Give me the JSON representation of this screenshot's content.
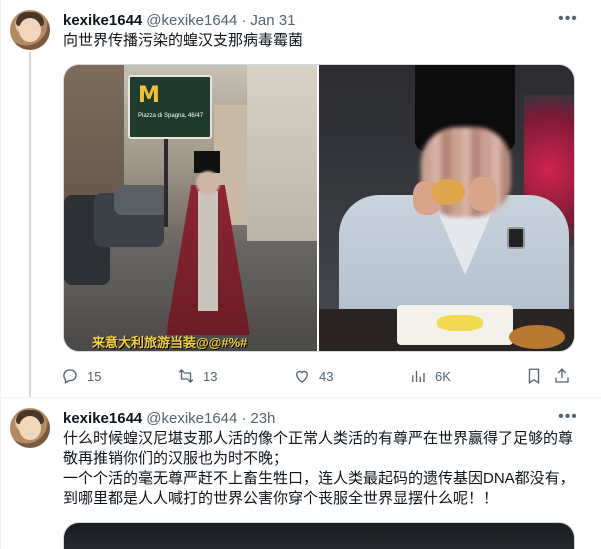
{
  "tweets": [
    {
      "display_name": "kexike1644",
      "handle": "@kexike1644",
      "dot": "·",
      "time": "Jan 31",
      "text": "向世界传播污染的蝗汉支那病毒霉菌",
      "media_caption": "来意大利旅游当装@@#%#",
      "sign_logo": "M",
      "sign_text": "Piazza di Spagna, 46/47",
      "actions": {
        "replies": "15",
        "retweets": "13",
        "likes": "43",
        "views": "6K"
      }
    },
    {
      "display_name": "kexike1644",
      "handle": "@kexike1644",
      "dot": "·",
      "time": "23h",
      "text": "什么时候蝗汉尼堪支那人活的像个正常人类活的有尊严在世界赢得了足够的尊\n敬再推销你们的汉服也为时不晚；\n一个个活的毫无尊严赶不上畜生牲口，连人类最起码的遗传基因DNA都没有，\n到哪里都是人人喊打的世界公害你穿个丧服全世界显摆什么呢！！"
    }
  ],
  "icons": {
    "more": "more-horizontal-icon",
    "reply": "reply-icon",
    "retweet": "retweet-icon",
    "like": "heart-icon",
    "views": "views-bar-chart-icon",
    "bookmark": "bookmark-icon",
    "share": "share-icon"
  },
  "colors": {
    "text_primary": "#0f1419",
    "text_secondary": "#536471",
    "border": "#cfd9de"
  }
}
